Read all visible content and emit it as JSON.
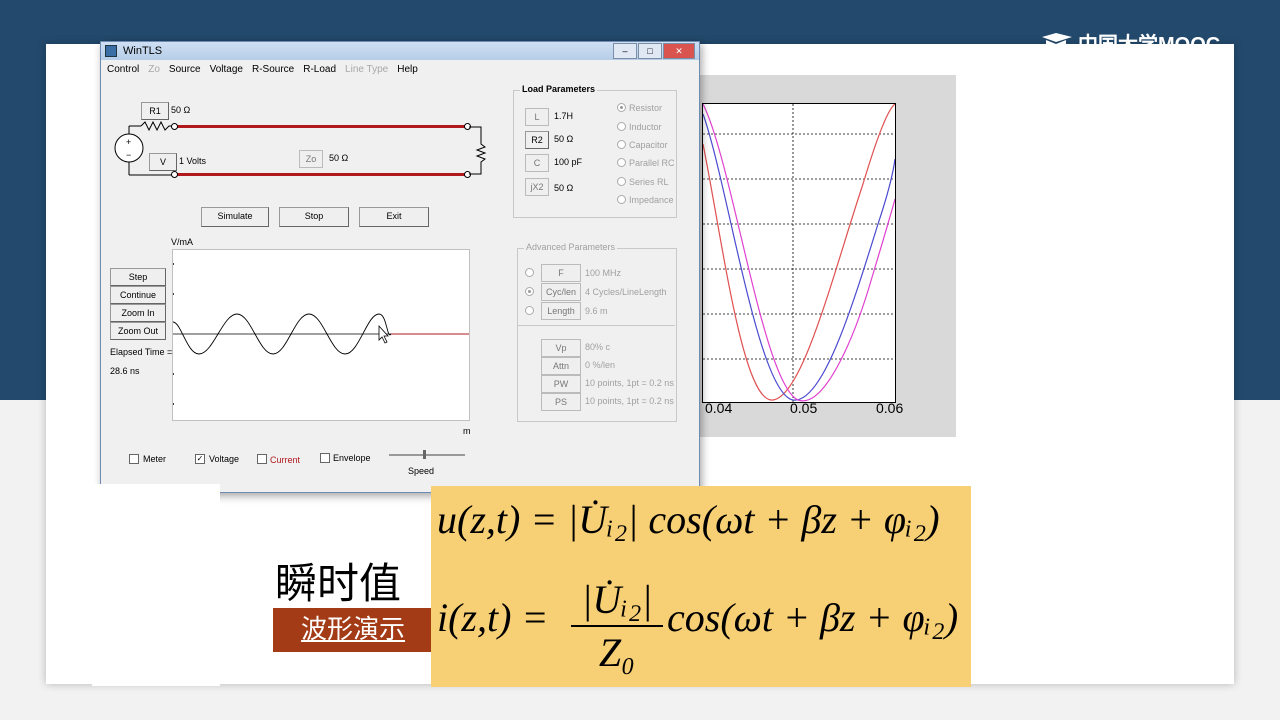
{
  "logo": {
    "text": "中国大学MOOC"
  },
  "plot": {
    "ticks": [
      "0.04",
      "0.05",
      "0.06"
    ]
  },
  "window": {
    "title": "WinTLS",
    "menu": [
      "Control",
      "Zo",
      "Source",
      "Voltage",
      "R-Source",
      "R-Load",
      "Line Type",
      "Help"
    ],
    "circuit": {
      "r1_label": "R1",
      "r1_value": "50 Ω",
      "v_label": "V",
      "v_value": "1 Volts",
      "zo_label": "Zo",
      "zo_value": "50 Ω"
    },
    "buttons": {
      "simulate": "Simulate",
      "stop": "Stop",
      "exit": "Exit"
    },
    "side_buttons": {
      "step": "Step",
      "continue": "Continue",
      "zoom_in": "Zoom In",
      "zoom_out": "Zoom Out"
    },
    "graph": {
      "ylabel": "V/mA",
      "xlabel": "m"
    },
    "elapsed_label": "Elapsed Time =",
    "elapsed_value": "28.6 ns",
    "load": {
      "title": "Load Parameters",
      "items": [
        {
          "btn": "L",
          "value": "1.7H"
        },
        {
          "btn": "R2",
          "value": "50 Ω"
        },
        {
          "btn": "C",
          "value": "100 pF"
        },
        {
          "btn": "jX2",
          "value": "50 Ω"
        }
      ],
      "radios": [
        "Resistor",
        "Inductor",
        "Capacitor",
        "Parallel RC",
        "Series RL",
        "Impedance"
      ]
    },
    "advanced": {
      "title": "Advanced Parameters",
      "items": [
        {
          "btn": "F",
          "value": "100 MHz"
        },
        {
          "btn": "Cyc/len",
          "value": "4 Cycles/LineLength"
        },
        {
          "btn": "Length",
          "value": "9.6 m"
        }
      ],
      "items2": [
        {
          "btn": "Vp",
          "value": "80% c"
        },
        {
          "btn": "Attn",
          "value": "0 %/len"
        },
        {
          "btn": "PW",
          "value": "10 points, 1pt = 0.2 ns"
        },
        {
          "btn": "PS",
          "value": "10 points, 1pt = 0.2 ns"
        }
      ]
    },
    "checkboxes": {
      "meter": "Meter",
      "voltage": "Voltage",
      "current": "Current",
      "envelope": "Envelope"
    },
    "speed_label": "Speed"
  },
  "slide": {
    "heading": "瞬时值",
    "demo_button": "波形演示",
    "formula1": "u(z,t) = |U̇ᵢ₂| cos(ωt + βz + φᵢ₂)",
    "formula2_lhs": "i(z,t) =",
    "formula2_num": "|U̇ᵢ₂|",
    "formula2_den": "Z₀",
    "formula2_rhs": "cos(ωt + βz + φᵢ₂)"
  },
  "colors": {
    "header": "#234a6d",
    "wire": "#b0181e",
    "formula_bg": "#f7cf75",
    "demo_btn": "#a33b16"
  }
}
